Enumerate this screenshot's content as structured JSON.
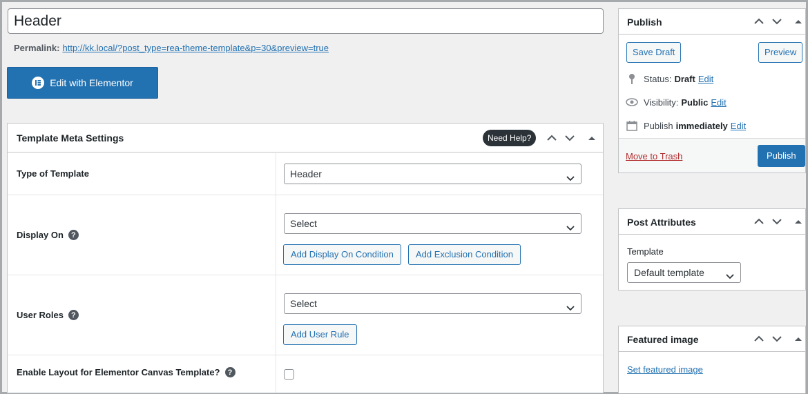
{
  "title": {
    "value": "Header"
  },
  "permalink": {
    "label": "Permalink:",
    "url": "http://kk.local/?post_type=rea-theme-template&p=30&preview=true"
  },
  "elementor": {
    "label": "Edit with Elementor"
  },
  "meta": {
    "title": "Template Meta Settings",
    "need_help": "Need Help?",
    "type": {
      "label": "Type of Template",
      "value": "Header"
    },
    "display_on": {
      "label": "Display On",
      "value": "Select",
      "add_label": "Add Display On Condition",
      "exclude_label": "Add Exclusion Condition"
    },
    "user_roles": {
      "label": "User Roles",
      "value": "Select",
      "add_label": "Add User Rule"
    },
    "canvas": {
      "label": "Enable Layout for Elementor Canvas Template?"
    }
  },
  "publish": {
    "title": "Publish",
    "save_draft": "Save Draft",
    "preview": "Preview",
    "status_label": "Status:",
    "status_value": "Draft",
    "visibility_label": "Visibility:",
    "visibility_value": "Public",
    "schedule_label": "Publish",
    "schedule_value": "immediately",
    "edit": "Edit",
    "trash": "Move to Trash",
    "publish_btn": "Publish"
  },
  "attributes": {
    "title": "Post Attributes",
    "template_label": "Template",
    "template_value": "Default template"
  },
  "featured": {
    "title": "Featured image",
    "set_link": "Set featured image"
  },
  "colors": {
    "accent": "#2271b1",
    "background": "#f0f0f1",
    "trash": "#b32d2e"
  }
}
